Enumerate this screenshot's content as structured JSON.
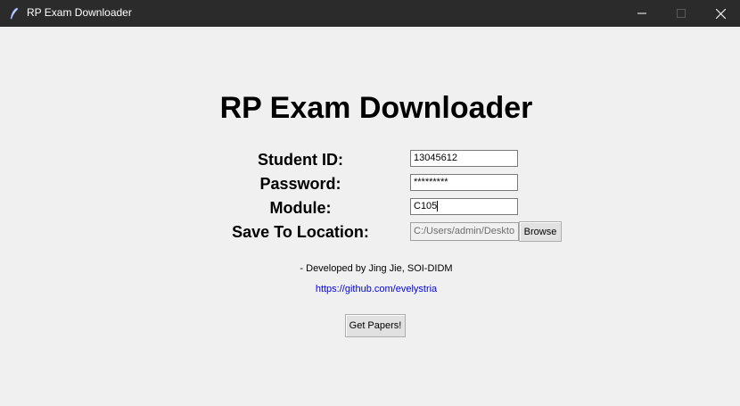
{
  "window": {
    "title": "RP Exam Downloader",
    "icon": "feather-icon",
    "controls": [
      "minimize-icon",
      "maximize-icon",
      "close-icon"
    ]
  },
  "app": {
    "heading": "RP Exam Downloader"
  },
  "form": {
    "student_id": {
      "label": "Student ID:",
      "value": "13045612"
    },
    "password": {
      "label": "Password:",
      "value": "*********"
    },
    "module": {
      "label": "Module:",
      "value": "C105"
    },
    "save_location": {
      "label": "Save To Location:",
      "value": "C:/Users/admin/Deskto"
    },
    "browse_label": "Browse"
  },
  "footer": {
    "developer": "- Developed by Jing Jie, SOI-DIDM",
    "link": "https://github.com/evelystria"
  },
  "actions": {
    "get_papers_label": "Get Papers!"
  },
  "colors": {
    "titlebar": "#2b2b2b",
    "background": "#f0f0f0",
    "link": "#0000ee"
  }
}
